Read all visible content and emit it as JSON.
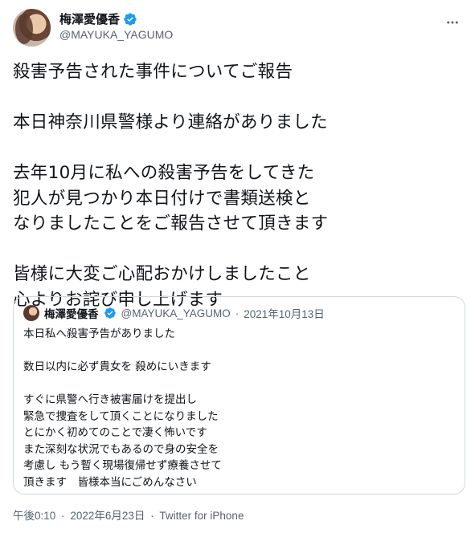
{
  "author": {
    "name": "梅澤愛優香",
    "handle": "@MAYUKA_YAGUMO"
  },
  "tweet": {
    "lines": [
      "殺害予告された事件についてご報告",
      "",
      "本日神奈川県警様より連絡がありました",
      "",
      "去年10月に私への殺害予告をしてきた",
      "犯人が見つかり本日付けで書類送検と",
      "なりましたことをご報告させて頂きます",
      "",
      "皆様に大変ご心配おかけしましたこと",
      "心よりお詫び申し上げます"
    ]
  },
  "quote": {
    "name": "梅澤愛優香",
    "handle": "@MAYUKA_YAGUMO",
    "separator": "·",
    "date": "2021年10月13日",
    "lines": [
      "本日私へ殺害予告がありました",
      "",
      "数日以内に必ず貴女を 殺めにいきます",
      "",
      "すぐに県警へ行き被害届けを提出し",
      "緊急で捜査をして頂くことになりました",
      "とにかく初めてのことで凄く怖いです",
      "また深刻な状況でもあるので身の安全を",
      "考慮し もう暫く現場復帰せず療養させて",
      "頂きます　皆様本当にごめんなさい"
    ]
  },
  "footer": {
    "time": "午後0:10",
    "sep1": "·",
    "date": "2022年6月23日",
    "sep2": "·",
    "source": "Twitter for iPhone"
  },
  "colors": {
    "verified": "#1d9bf0",
    "muted": "#536471",
    "border": "#cfd9de"
  },
  "icons": {
    "verified": "verified-badge-icon",
    "more": "more-icon"
  }
}
